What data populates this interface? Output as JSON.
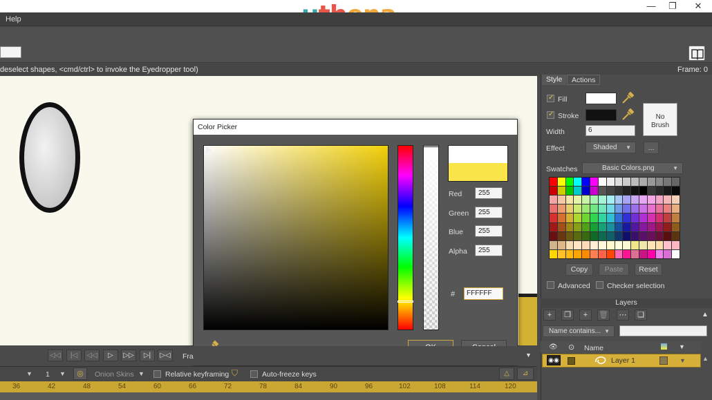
{
  "app": {
    "logo_text": [
      "u",
      "th",
      "ena"
    ],
    "window_controls": [
      "—",
      "❐",
      "✕"
    ]
  },
  "menu": {
    "help": "Help"
  },
  "statusbar": {
    "hint": "deselect shapes, <cmd/ctrl> to invoke the Eyedropper tool)",
    "frame": "Frame: 0"
  },
  "style_panel": {
    "tabs": [
      "Style",
      "Actions"
    ],
    "fill_label": "Fill",
    "fill_checked": true,
    "fill_color": "#ffffff",
    "stroke_label": "Stroke",
    "stroke_checked": true,
    "stroke_color": "#111111",
    "width_label": "Width",
    "width_value": "6",
    "effect_label": "Effect",
    "effect_value": "Shaded",
    "effect_more": "...",
    "no_brush": [
      "No",
      "Brush"
    ],
    "swatches_label": "Swatches",
    "swatches_value": "Basic Colors.png",
    "copy": "Copy",
    "paste": "Paste",
    "reset": "Reset",
    "advanced": "Advanced",
    "checker": "Checker selection",
    "swatch_colors": [
      "#ff0000",
      "#ffff00",
      "#00ff00",
      "#00ffff",
      "#0000ff",
      "#ff00ff",
      "#ffffff",
      "#eeeeee",
      "#dddddd",
      "#cccccc",
      "#bbbbbb",
      "#aaaaaa",
      "#999999",
      "#888888",
      "#777777",
      "#666666",
      "#cc0000",
      "#cccc00",
      "#00cc00",
      "#00cccc",
      "#0000cc",
      "#cc00cc",
      "#555555",
      "#444444",
      "#333333",
      "#222222",
      "#111111",
      "#000000",
      "#3a3a3a",
      "#2a2a2a",
      "#1a1a1a",
      "#0a0a0a",
      "#f4a6a6",
      "#f4c8a6",
      "#f4e6a6",
      "#e6f4a6",
      "#c8f4a6",
      "#a6f4b0",
      "#a6f4d6",
      "#a6ecf4",
      "#a6c8f4",
      "#a6a6f4",
      "#c8a6f4",
      "#e6a6f4",
      "#f4a6e6",
      "#f4a6c8",
      "#f4b6b6",
      "#f4d0b6",
      "#e87070",
      "#e89c70",
      "#e8cc70",
      "#cce870",
      "#9ce870",
      "#70e884",
      "#70e8bc",
      "#70d8e8",
      "#709ce8",
      "#7070e8",
      "#9c70e8",
      "#cc70e8",
      "#e870cc",
      "#e8709c",
      "#e88080",
      "#e8b080",
      "#d63030",
      "#d67030",
      "#d6b030",
      "#b0d630",
      "#70d630",
      "#30d650",
      "#30d6a0",
      "#30c0d6",
      "#3070d6",
      "#3030d6",
      "#7030d6",
      "#b030d6",
      "#d630b0",
      "#d63070",
      "#c04040",
      "#c08040",
      "#a01818",
      "#a05018",
      "#a08818",
      "#88a018",
      "#50a018",
      "#18a038",
      "#18a078",
      "#1890a0",
      "#1850a0",
      "#1818a0",
      "#5018a0",
      "#8818a0",
      "#a01888",
      "#a01850",
      "#901c1c",
      "#905c1c",
      "#6a1010",
      "#6a3810",
      "#6a5a10",
      "#5a6a10",
      "#386a10",
      "#106a26",
      "#106a50",
      "#10606a",
      "#10386a",
      "#10106a",
      "#38106a",
      "#5a106a",
      "#6a105a",
      "#6a1038",
      "#5a0e0e",
      "#5a340e",
      "#d2b48c",
      "#deb887",
      "#f5deb3",
      "#ffe4c4",
      "#ffdab9",
      "#ffefd5",
      "#fff8dc",
      "#fffacd",
      "#ffffe0",
      "#fafad2",
      "#f0e68c",
      "#eee8aa",
      "#ffe4b5",
      "#ffdead",
      "#ffc0cb",
      "#ffb6c1",
      "#ffd700",
      "#ffc125",
      "#ffb90f",
      "#ffa500",
      "#ff8c00",
      "#ff7f50",
      "#ff6347",
      "#ff4500",
      "#ff69b4",
      "#ff1493",
      "#db7093",
      "#c71585",
      "#ff00aa",
      "#ee82ee",
      "#da70d6",
      "#ffffff"
    ]
  },
  "layers": {
    "header": "Layers",
    "name_filter": "Name contains...",
    "col_name": "Name",
    "layer1": "Layer 1"
  },
  "color_picker": {
    "title": "Color Picker",
    "new_color": "#ffffff",
    "old_color": "#f9e44a",
    "red_label": "Red",
    "red": "255",
    "green_label": "Green",
    "green": "255",
    "blue_label": "Blue",
    "blue": "255",
    "alpha_label": "Alpha",
    "alpha": "255",
    "hash": "#",
    "hex": "FFFFFF",
    "ok": "OK",
    "cancel": "Cancel"
  },
  "timeline": {
    "frame_label": "Fra",
    "onion_skins": "Onion Skins",
    "frame_step": "1",
    "relative_keyframing": "Relative keyframing",
    "auto_freeze": "Auto-freeze keys",
    "ruler_ticks": [
      "36",
      "42",
      "48",
      "54",
      "60",
      "66",
      "72",
      "78",
      "84",
      "90",
      "96",
      "102",
      "108",
      "114",
      "120"
    ]
  }
}
